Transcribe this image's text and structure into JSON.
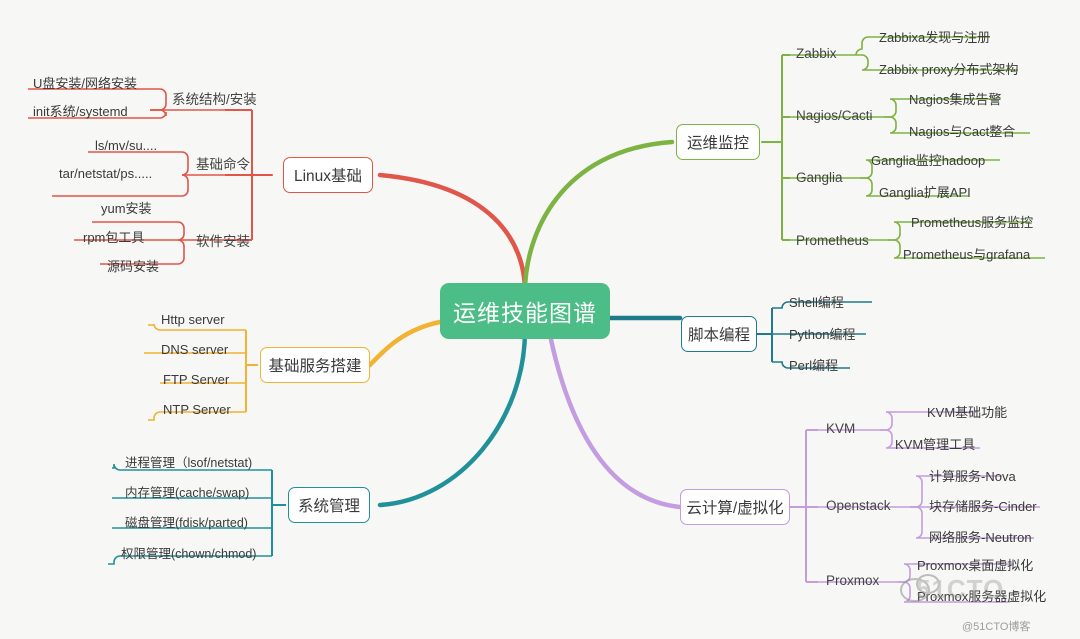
{
  "title": "运维技能图谱",
  "footer": {
    "credit": "@51CTO博客",
    "watermark": "51CTO"
  },
  "colors": {
    "root_bg": "#4cbd87",
    "linux": "#e0564a",
    "monitor": "#7cb342",
    "script": "#1f7a8c",
    "service": "#f2b233",
    "system": "#219199",
    "cloud": "#c49ce0",
    "background": "#f7f7f5"
  },
  "branches": [
    {
      "id": "linux",
      "label": "Linux基础",
      "color": "#e0564a",
      "side": "left",
      "children": [
        {
          "label": "系统结构/安装",
          "items": [
            "U盘安装/网络安装",
            "init系统/systemd"
          ]
        },
        {
          "label": "基础命令",
          "items": [
            "ls/mv/su....",
            "tar/netstat/ps....."
          ]
        },
        {
          "label": "软件安装",
          "items": [
            "yum安装",
            "rpm包工具",
            "源码安装"
          ]
        }
      ]
    },
    {
      "id": "monitor",
      "label": "运维监控",
      "color": "#7cb342",
      "side": "right",
      "children": [
        {
          "label": "Zabbix",
          "items": [
            "Zabbixa发现与注册",
            "Zabbix proxy分布式架构"
          ]
        },
        {
          "label": "Nagios/Cacti",
          "items": [
            "Nagios集成告警",
            "Nagios与Cact整合"
          ]
        },
        {
          "label": "Ganglia",
          "items": [
            "Ganglia监控hadoop",
            "Ganglia扩展API"
          ]
        },
        {
          "label": "Prometheus",
          "items": [
            "Prometheus服务监控",
            "Prometheus与grafana"
          ]
        }
      ]
    },
    {
      "id": "script",
      "label": "脚本编程",
      "color": "#1f7a8c",
      "side": "right",
      "children": [
        {
          "label": "Shell编程",
          "items": []
        },
        {
          "label": "Python编程",
          "items": []
        },
        {
          "label": "Perl编程",
          "items": []
        }
      ]
    },
    {
      "id": "service",
      "label": "基础服务搭建",
      "color": "#f2b233",
      "side": "left",
      "children": [
        {
          "label": "Http server",
          "items": []
        },
        {
          "label": "DNS server",
          "items": []
        },
        {
          "label": "FTP Server",
          "items": []
        },
        {
          "label": "NTP Server",
          "items": []
        }
      ]
    },
    {
      "id": "system",
      "label": "系统管理",
      "color": "#219199",
      "side": "left",
      "children": [
        {
          "label": "进程管理（lsof/netstat)",
          "items": []
        },
        {
          "label": "内存管理(cache/swap)",
          "items": []
        },
        {
          "label": "磁盘管理(fdisk/parted)",
          "items": []
        },
        {
          "label": "权限管理(chown/chmod)",
          "items": []
        }
      ]
    },
    {
      "id": "cloud",
      "label": "云计算/虚拟化",
      "color": "#c49ce0",
      "side": "right",
      "children": [
        {
          "label": "KVM",
          "items": [
            "KVM基础功能",
            "KVM管理工具"
          ]
        },
        {
          "label": "Openstack",
          "items": [
            "计算服务-Nova",
            "块存储服务-Cinder",
            "网络服务-Neutron"
          ]
        },
        {
          "label": "Proxmox",
          "items": [
            "Proxmox桌面虚拟化",
            "Proxmox服务器虚拟化"
          ]
        }
      ]
    }
  ]
}
